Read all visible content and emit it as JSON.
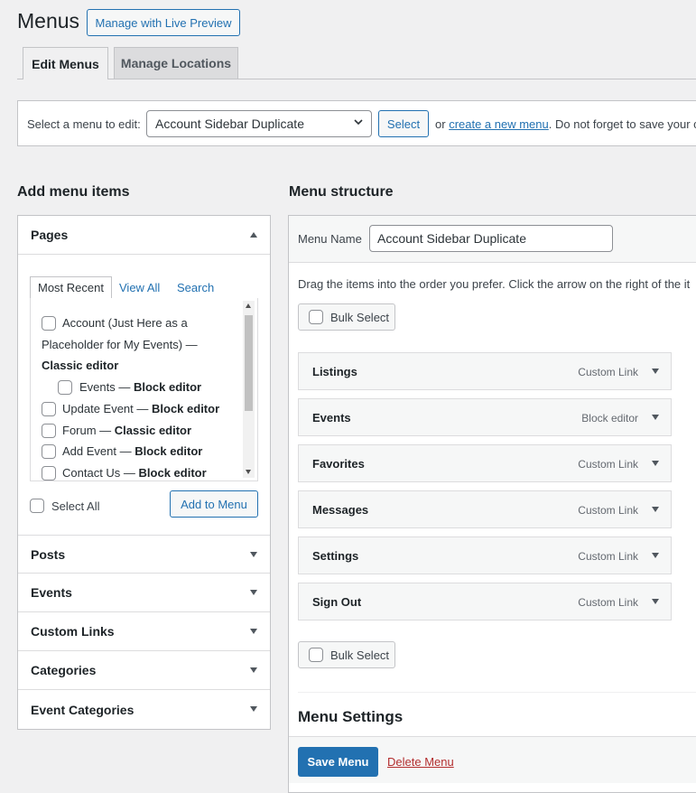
{
  "page": {
    "title": "Menus",
    "live_preview_button": "Manage with Live Preview"
  },
  "tabs": [
    {
      "label": "Edit Menus",
      "active": true
    },
    {
      "label": "Manage Locations",
      "active": false
    }
  ],
  "select_bar": {
    "label": "Select a menu to edit:",
    "selected_menu": "Account Sidebar Duplicate",
    "select_button": "Select",
    "or_text": "or",
    "create_link": "create a new menu",
    "after_text": ". Do not forget to save your c"
  },
  "add_items": {
    "heading": "Add menu items",
    "pages_section": "Pages",
    "inner_tabs": [
      "Most Recent",
      "View All",
      "Search"
    ],
    "pages": [
      {
        "line1": "Account (Just Here as a",
        "line2": "Placeholder for My Events) —",
        "line3": "Classic editor"
      },
      {
        "title": "Events",
        "editor": "Block editor"
      },
      {
        "title": "Update Event",
        "editor": "Block editor"
      },
      {
        "title": "Forum",
        "editor": "Classic editor"
      },
      {
        "title": "Add Event",
        "editor": "Block editor"
      },
      {
        "title": "Contact Us",
        "editor": "Block editor"
      }
    ],
    "sep": " — ",
    "select_all": "Select All",
    "add_to_menu": "Add to Menu",
    "sections": [
      "Posts",
      "Events",
      "Custom Links",
      "Categories",
      "Event Categories"
    ]
  },
  "structure": {
    "heading": "Menu structure",
    "menu_name_label": "Menu Name",
    "menu_name_value": "Account Sidebar Duplicate",
    "instructions": "Drag the items into the order you prefer. Click the arrow on the right of the it",
    "bulk_select": "Bulk Select",
    "items": [
      {
        "title": "Listings",
        "type": "Custom Link"
      },
      {
        "title": "Events",
        "type": "Block editor"
      },
      {
        "title": "Favorites",
        "type": "Custom Link"
      },
      {
        "title": "Messages",
        "type": "Custom Link"
      },
      {
        "title": "Settings",
        "type": "Custom Link"
      },
      {
        "title": "Sign Out",
        "type": "Custom Link"
      }
    ],
    "settings_heading": "Menu Settings",
    "save_button": "Save Menu",
    "delete_link": "Delete Menu"
  },
  "colors": {
    "accent": "#2271b1",
    "danger": "#b32d2e",
    "background": "#f0f0f1"
  }
}
